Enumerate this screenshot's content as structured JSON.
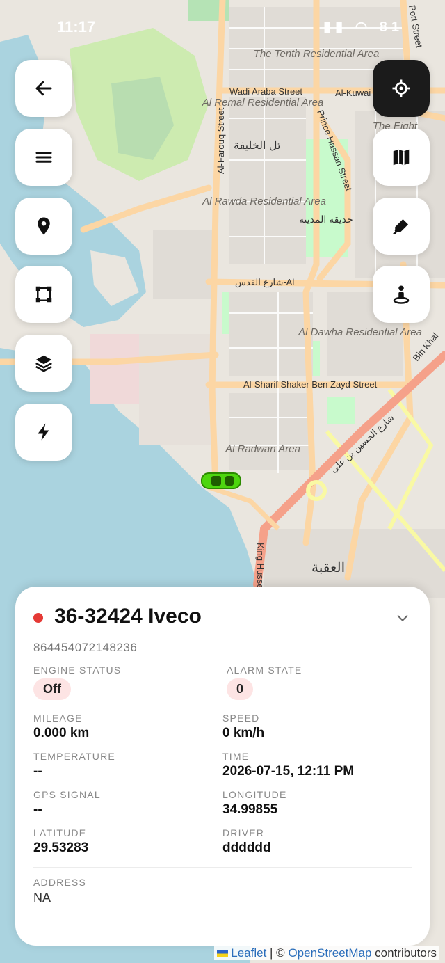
{
  "status_bar": {
    "time": "11:17",
    "battery": "81"
  },
  "map": {
    "labels": {
      "tenth_residential": "The Tenth Residential Area",
      "wadi_araba": "Wadi Araba Street",
      "al_kuwait": "Al-Kuwai",
      "al_remal": "Al Remal Residential Area",
      "al_rawda": "Al Rawda Residential Area",
      "al_dawha": "Al Dawha Residential Area",
      "al_radwan": "Al Radwan Area",
      "prince_hassan": "Prince Hassan Street",
      "al_farouq": "Al-Farouq Street",
      "sharif_shaker": "Al-Sharif Shaker Ben Zayd Street",
      "tal_al_khalifa": "تل الخليفة",
      "hadiqat_al_madina": "حديقة المدينة",
      "shari_al_quds": "شارع القدس-Al",
      "shari_al_hussein": "شارع الحسين بن علي",
      "aqaba_ar": "العقبة",
      "king_hussein": "King Husse",
      "bin_khal": "Bin Khal",
      "port_street": "Port Street",
      "the_eight": "The Eight"
    },
    "colors": {
      "water": "#aad3df",
      "land": "#f2efe9",
      "park": "#c8facc",
      "road_major": "#fcd6a4",
      "road_trunk": "#f9b29c"
    }
  },
  "left_buttons": [
    {
      "name": "back-button",
      "icon": "arrow-left-icon"
    },
    {
      "name": "menu-button",
      "icon": "hamburger-icon"
    },
    {
      "name": "location-pin-button",
      "icon": "map-pin-icon"
    },
    {
      "name": "geofence-button",
      "icon": "polygon-icon"
    },
    {
      "name": "layers-button",
      "icon": "layers-icon"
    },
    {
      "name": "events-button",
      "icon": "lightning-icon"
    }
  ],
  "right_buttons": [
    {
      "name": "locate-button",
      "icon": "crosshair-icon"
    },
    {
      "name": "map-type-button",
      "icon": "map-icon"
    },
    {
      "name": "draw-button",
      "icon": "pen-icon"
    },
    {
      "name": "street-view-button",
      "icon": "person-pin-icon"
    }
  ],
  "vehicle": {
    "title": "36-32424 Iveco",
    "imei": "864454072148236",
    "status_color": "#e53935",
    "fields": {
      "engine_status_label": "ENGINE STATUS",
      "engine_status": "Off",
      "alarm_state_label": "ALARM STATE",
      "alarm_state": "0",
      "mileage_label": "MILEAGE",
      "mileage": "0.000 km",
      "speed_label": "SPEED",
      "speed": "0 km/h",
      "temperature_label": "TEMPERATURE",
      "temperature": "--",
      "time_label": "TIME",
      "time": "2026-07-15, 12:11 PM",
      "gps_label": "GPS SIGNAL",
      "gps": "--",
      "longitude_label": "LONGITUDE",
      "longitude": "34.99855",
      "latitude_label": "LATITUDE",
      "latitude": "29.53283",
      "driver_label": "DRIVER",
      "driver": "dddddd",
      "address_label": "ADDRESS",
      "address": "NA"
    }
  },
  "attribution": {
    "leaflet": "Leaflet",
    "sep": " | © ",
    "osm": "OpenStreetMap",
    "contributors": " contributors"
  }
}
